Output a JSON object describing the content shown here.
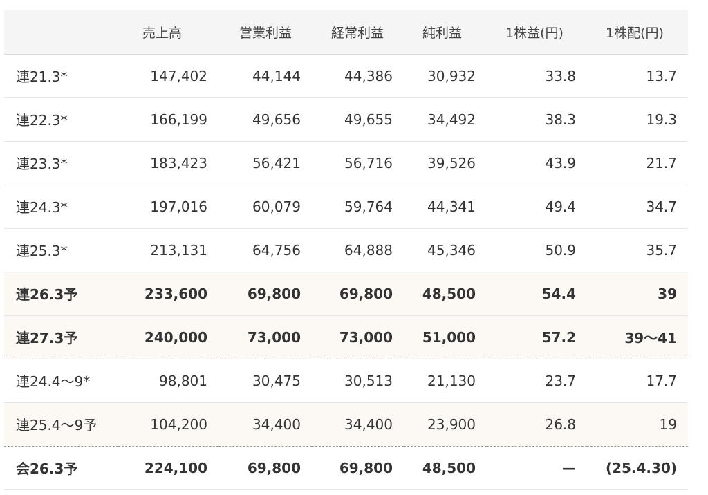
{
  "headers": [
    "",
    "売上高",
    "営業利益",
    "経常利益",
    "純利益",
    "1株益(円)",
    "1株配(円)"
  ],
  "rows": [
    {
      "label": "連21.3*",
      "values": [
        "147,402",
        "44,144",
        "44,386",
        "30,932",
        "33.8",
        "13.7"
      ]
    },
    {
      "label": "連22.3*",
      "values": [
        "166,199",
        "49,656",
        "49,655",
        "34,492",
        "38.3",
        "19.3"
      ]
    },
    {
      "label": "連23.3*",
      "values": [
        "183,423",
        "56,421",
        "56,716",
        "39,526",
        "43.9",
        "21.7"
      ]
    },
    {
      "label": "連24.3*",
      "values": [
        "197,016",
        "60,079",
        "59,764",
        "44,341",
        "49.4",
        "34.7"
      ]
    },
    {
      "label": "連25.3*",
      "values": [
        "213,131",
        "64,756",
        "64,888",
        "45,346",
        "50.9",
        "35.7"
      ]
    },
    {
      "label": "連26.3予",
      "values": [
        "233,600",
        "69,800",
        "69,800",
        "48,500",
        "54.4",
        "39"
      ]
    },
    {
      "label": "連27.3予",
      "values": [
        "240,000",
        "73,000",
        "73,000",
        "51,000",
        "57.2",
        "39〜41"
      ]
    },
    {
      "label": "連24.4〜9*",
      "values": [
        "98,801",
        "30,475",
        "30,513",
        "21,130",
        "23.7",
        "17.7"
      ]
    },
    {
      "label": "連25.4〜9予",
      "values": [
        "104,200",
        "34,400",
        "34,400",
        "23,900",
        "26.8",
        "19"
      ]
    },
    {
      "label": "会26.3予",
      "values": [
        "224,100",
        "69,800",
        "69,800",
        "48,500",
        "—",
        "(25.4.30)"
      ]
    }
  ]
}
